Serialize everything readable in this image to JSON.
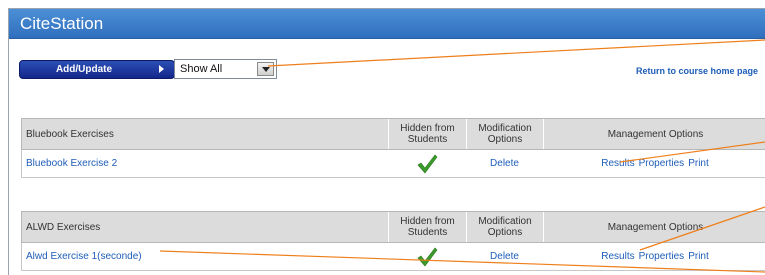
{
  "app": {
    "title": "CiteStation"
  },
  "toolbar": {
    "add_update_label": "Add/Update",
    "filter_value": "Show All",
    "return_link": "Return to course home page"
  },
  "columns": {
    "hidden": "Hidden from Students",
    "modification": "Modification Options",
    "management": "Management Options"
  },
  "sections": [
    {
      "title": "Bluebook Exercises",
      "rows": [
        {
          "name": "Bluebook Exercise 2",
          "hidden": true,
          "delete": "Delete",
          "results": "Results",
          "properties": "Properties",
          "print": "Print"
        }
      ]
    },
    {
      "title": "ALWD Exercises",
      "rows": [
        {
          "name": "Alwd Exercise 1(seconde)",
          "hidden": true,
          "delete": "Delete",
          "results": "Results",
          "properties": "Properties",
          "print": "Print"
        }
      ]
    }
  ],
  "colors": {
    "title_bar": "#3d7fcc",
    "link": "#1e5db8",
    "button": "#1c3598",
    "check": "#3c9a2c",
    "callout": "#ef7f1a"
  }
}
